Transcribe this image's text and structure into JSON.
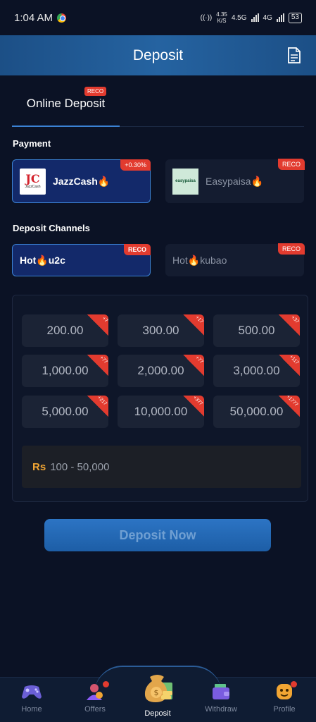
{
  "status_bar": {
    "time": "1:04 AM",
    "speed_value": "4.35",
    "speed_unit": "K/S",
    "network_1": "4.5G",
    "network_2": "4G",
    "battery": "53"
  },
  "header": {
    "title": "Deposit",
    "record_icon": "document-icon"
  },
  "tabs": {
    "online_deposit": "Online Deposit",
    "reco_badge": "RECO"
  },
  "payment": {
    "section_label": "Payment",
    "methods": [
      {
        "name": "JazzCash🔥",
        "logo_text": "JazzCash",
        "badge": "+0.30%",
        "selected": true
      },
      {
        "name": "Easypaisa🔥",
        "logo_text": "easypaisa",
        "badge": "RECO",
        "selected": false
      }
    ]
  },
  "channels": {
    "section_label": "Deposit Channels",
    "items": [
      {
        "name": "Hot🔥u2c",
        "badge": "RECO",
        "selected": true
      },
      {
        "name": "Hot🔥kubao",
        "badge": "RECO",
        "selected": false
      }
    ]
  },
  "amounts": [
    {
      "value": "200.00",
      "bonus": "+7"
    },
    {
      "value": "300.00",
      "bonus": "+17"
    },
    {
      "value": "500.00",
      "bonus": "+37"
    },
    {
      "value": "1,000.00",
      "bonus": "+77"
    },
    {
      "value": "2,000.00",
      "bonus": "+77"
    },
    {
      "value": "3,000.00",
      "bonus": "+117"
    },
    {
      "value": "5,000.00",
      "bonus": "+217"
    },
    {
      "value": "10,000.00",
      "bonus": "+377"
    },
    {
      "value": "50,000.00",
      "bonus": "+1777"
    }
  ],
  "range": {
    "currency": "Rs",
    "limits": "100 - 50,000"
  },
  "deposit_button": "Deposit Now",
  "bottom_nav": {
    "home": "Home",
    "offers": "Offers",
    "deposit": "Deposit",
    "withdraw": "Withdraw",
    "profile": "Profile"
  },
  "colors": {
    "background": "#0b1225",
    "header": "#2563a1",
    "accent": "#3b82d4",
    "badge_red": "#e23b2f",
    "currency_orange": "#f1a533"
  }
}
